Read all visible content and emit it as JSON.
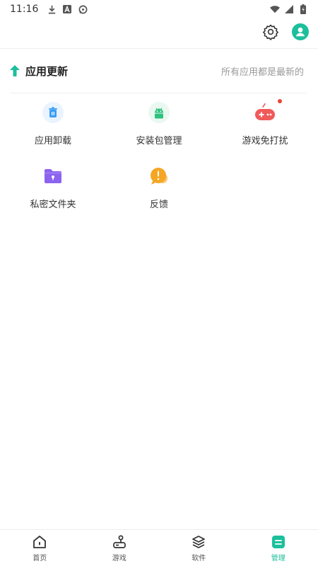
{
  "status_bar": {
    "time": "11:16",
    "left_icons": [
      "download-icon",
      "font-a-icon",
      "chat-icon"
    ],
    "right_icons": [
      "wifi-icon",
      "signal-icon",
      "battery-charging-icon"
    ]
  },
  "header": {
    "settings_icon": "gear-icon",
    "avatar_icon": "user-avatar-icon",
    "accent_color": "#1cbf9c"
  },
  "update": {
    "icon": "arrow-up-icon",
    "title": "应用更新",
    "status": "所有应用都是最新的"
  },
  "tools": [
    {
      "id": "uninstall",
      "label": "应用卸载",
      "icon": "trash-icon",
      "color": "#3b9ef5"
    },
    {
      "id": "package",
      "label": "安装包管理",
      "icon": "android-icon",
      "color": "#2ec27e"
    },
    {
      "id": "game-mode",
      "label": "游戏免打扰",
      "icon": "gamepad-icon",
      "color": "#f05a5a",
      "badge": true
    },
    {
      "id": "private-folder",
      "label": "私密文件夹",
      "icon": "folder-lock-icon",
      "color": "#8c63f0"
    },
    {
      "id": "feedback",
      "label": "反馈",
      "icon": "feedback-bubble-icon",
      "color": "#f5a623"
    }
  ],
  "bottom_nav": [
    {
      "label": "首页",
      "icon": "home-icon",
      "active": false
    },
    {
      "label": "游戏",
      "icon": "joystick-icon",
      "active": false
    },
    {
      "label": "软件",
      "icon": "layers-icon",
      "active": false
    },
    {
      "label": "管理",
      "icon": "manage-box-icon",
      "active": true
    }
  ]
}
